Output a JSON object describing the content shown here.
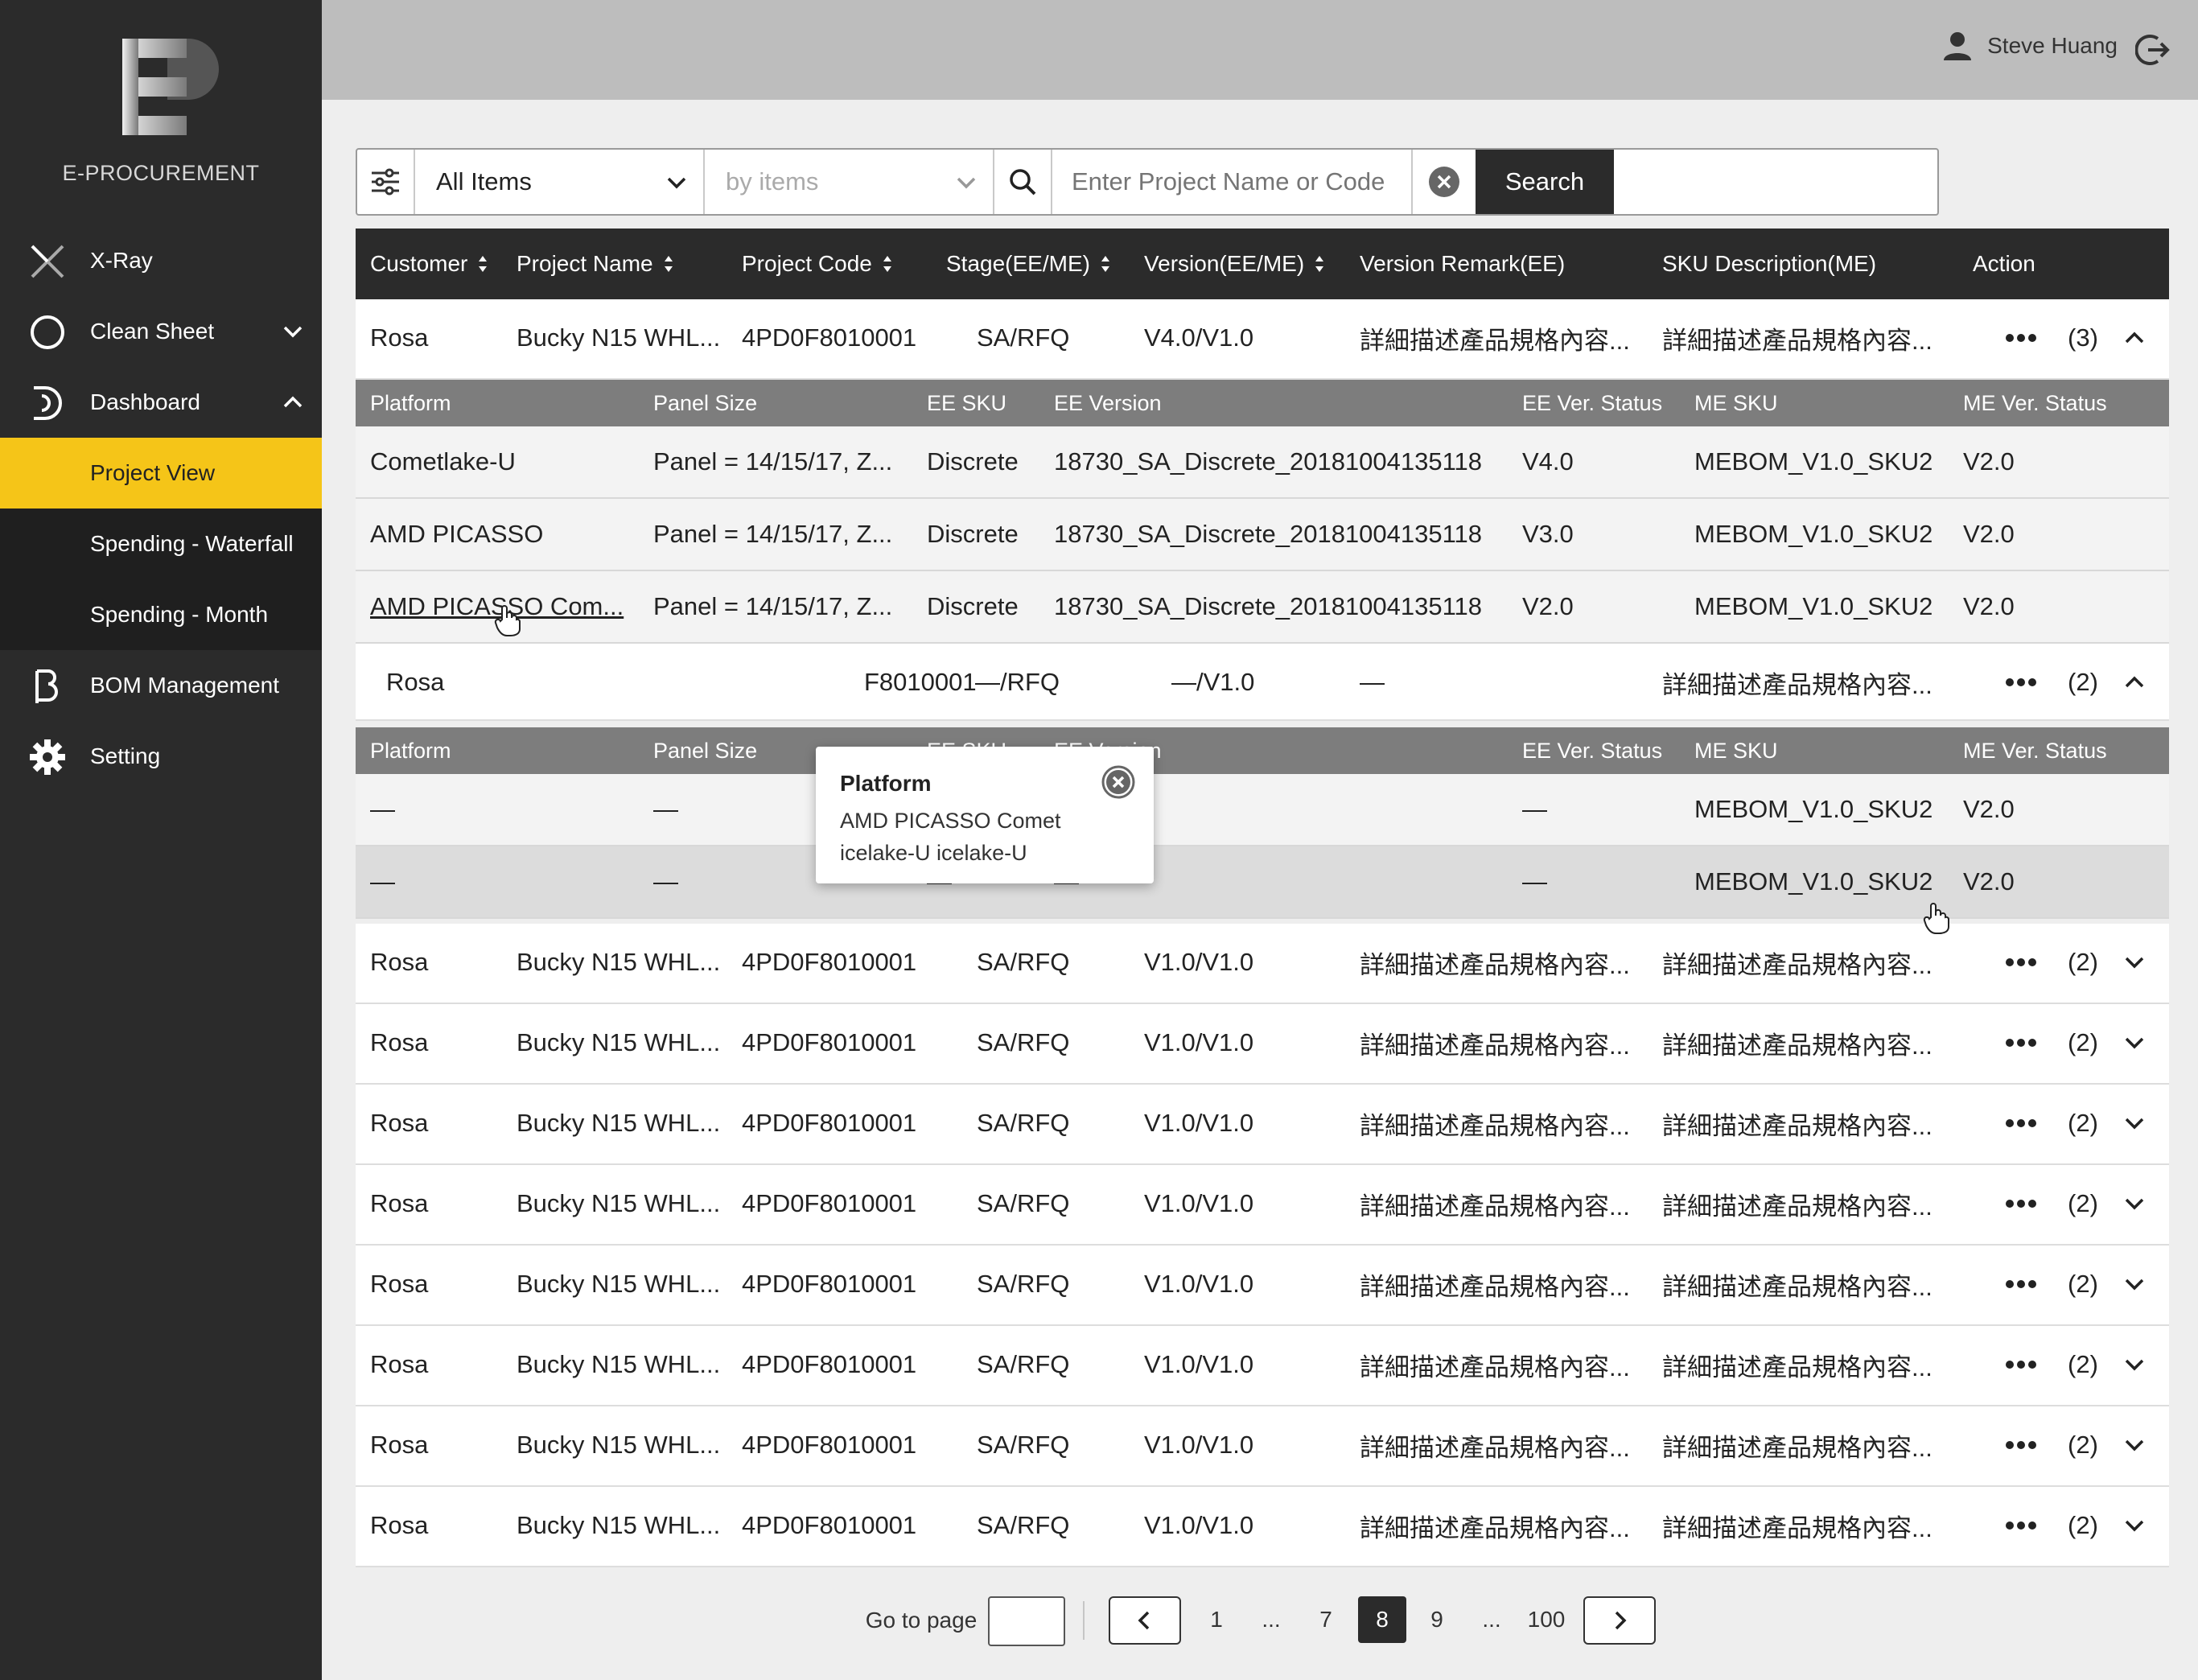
{
  "brand": "E-PROCUREMENT",
  "sidebar": {
    "items": [
      {
        "label": "X-Ray",
        "icon": "xray-icon"
      },
      {
        "label": "Clean Sheet",
        "icon": "circle-icon"
      },
      {
        "label": "Dashboard",
        "icon": "dashboard-icon"
      },
      {
        "label": "Project View"
      },
      {
        "label": "Spending - Waterfall"
      },
      {
        "label": "Spending - Month"
      },
      {
        "label": "BOM Management",
        "icon": "bom-icon"
      },
      {
        "label": "Setting",
        "icon": "gear-icon"
      }
    ],
    "active": "Project View"
  },
  "header": {
    "user_name": "Steve Huang"
  },
  "search": {
    "scope": "All Items",
    "by": "by items",
    "placeholder": "Enter Project Name or Code",
    "button": "Search"
  },
  "table": {
    "columns": [
      "Customer",
      "Project Name",
      "Project Code",
      "Stage(EE/ME)",
      "Version(EE/ME)",
      "Version Remark(EE)",
      "SKU Description(ME)",
      "Action"
    ],
    "sub_columns": [
      "Platform",
      "Panel Size",
      "EE SKU",
      "EE Version",
      "EE Ver. Status",
      "ME SKU",
      "ME Ver. Status"
    ],
    "row1": {
      "customer": "Rosa",
      "project": "Bucky N15 WHL...",
      "code": "4PD0F8010001",
      "stage": "SA/RFQ",
      "version": "V4.0/V1.0",
      "remark": "詳細描述產品規格內容...",
      "sku_desc": "詳細描述產品規格內容...",
      "count": "(3)"
    },
    "row1_subs": [
      {
        "platform": "Cometlake-U",
        "panel": "Panel = 14/15/17, Z...",
        "ee_sku": "Discrete",
        "ee_version": "18730_SA_Discrete_20181004135118",
        "ee_status": "V4.0",
        "me_sku": "MEBOM_V1.0_SKU2",
        "me_status": "V2.0"
      },
      {
        "platform": "AMD PICASSO",
        "panel": "Panel = 14/15/17, Z...",
        "ee_sku": "Discrete",
        "ee_version": "18730_SA_Discrete_20181004135118",
        "ee_status": "V3.0",
        "me_sku": "MEBOM_V1.0_SKU2",
        "me_status": "V2.0"
      },
      {
        "platform": "AMD PICASSO Com...",
        "panel": "Panel = 14/15/17, Z...",
        "ee_sku": "Discrete",
        "ee_version": "18730_SA_Discrete_20181004135118",
        "ee_status": "V2.0",
        "me_sku": "MEBOM_V1.0_SKU2",
        "me_status": "V2.0"
      }
    ],
    "row2": {
      "customer": "Rosa",
      "code_partial": "F8010001",
      "stage": "—/RFQ",
      "version": "—/V1.0",
      "remark": "—",
      "sku_desc": "詳細描述產品規格內容...",
      "count": "(2)"
    },
    "row2_subs": [
      {
        "platform": "—",
        "panel": "—",
        "ee_sku": "—",
        "ee_version": "—",
        "ee_status": "—",
        "me_sku": "MEBOM_V1.0_SKU2",
        "me_status": "V2.0"
      },
      {
        "platform": "—",
        "panel": "—",
        "ee_sku": "—",
        "ee_version": "—",
        "ee_status": "—",
        "me_sku": "MEBOM_V1.0_SKU2",
        "me_status": "V2.0"
      }
    ],
    "rows": [
      {
        "customer": "Rosa",
        "project": "Bucky N15 WHL...",
        "code": "4PD0F8010001",
        "stage": "SA/RFQ",
        "version": "V1.0/V1.0",
        "remark": "詳細描述產品規格內容...",
        "sku_desc": "詳細描述產品規格內容...",
        "count": "(2)"
      },
      {
        "customer": "Rosa",
        "project": "Bucky N15 WHL...",
        "code": "4PD0F8010001",
        "stage": "SA/RFQ",
        "version": "V1.0/V1.0",
        "remark": "詳細描述產品規格內容...",
        "sku_desc": "詳細描述產品規格內容...",
        "count": "(2)"
      },
      {
        "customer": "Rosa",
        "project": "Bucky N15 WHL...",
        "code": "4PD0F8010001",
        "stage": "SA/RFQ",
        "version": "V1.0/V1.0",
        "remark": "詳細描述產品規格內容...",
        "sku_desc": "詳細描述產品規格內容...",
        "count": "(2)"
      },
      {
        "customer": "Rosa",
        "project": "Bucky N15 WHL...",
        "code": "4PD0F8010001",
        "stage": "SA/RFQ",
        "version": "V1.0/V1.0",
        "remark": "詳細描述產品規格內容...",
        "sku_desc": "詳細描述產品規格內容...",
        "count": "(2)"
      },
      {
        "customer": "Rosa",
        "project": "Bucky N15 WHL...",
        "code": "4PD0F8010001",
        "stage": "SA/RFQ",
        "version": "V1.0/V1.0",
        "remark": "詳細描述產品規格內容...",
        "sku_desc": "詳細描述產品規格內容...",
        "count": "(2)"
      },
      {
        "customer": "Rosa",
        "project": "Bucky N15 WHL...",
        "code": "4PD0F8010001",
        "stage": "SA/RFQ",
        "version": "V1.0/V1.0",
        "remark": "詳細描述產品規格內容...",
        "sku_desc": "詳細描述產品規格內容...",
        "count": "(2)"
      },
      {
        "customer": "Rosa",
        "project": "Bucky N15 WHL...",
        "code": "4PD0F8010001",
        "stage": "SA/RFQ",
        "version": "V1.0/V1.0",
        "remark": "詳細描述產品規格內容...",
        "sku_desc": "詳細描述產品規格內容...",
        "count": "(2)"
      },
      {
        "customer": "Rosa",
        "project": "Bucky N15 WHL...",
        "code": "4PD0F8010001",
        "stage": "SA/RFQ",
        "version": "V1.0/V1.0",
        "remark": "詳細描述產品規格內容...",
        "sku_desc": "詳細描述產品規格內容...",
        "count": "(2)"
      }
    ]
  },
  "tooltip": {
    "title": "Platform",
    "body": "AMD PICASSO Comet icelake-U icelake-U"
  },
  "pagination": {
    "goto_label": "Go to page",
    "pages": [
      "1",
      "...",
      "7",
      "8",
      "9",
      "...",
      "100"
    ],
    "current": "8"
  },
  "colors": {
    "accent": "#f5c518",
    "sidebar": "#2b2b2b",
    "header": "#bdbdbd"
  }
}
